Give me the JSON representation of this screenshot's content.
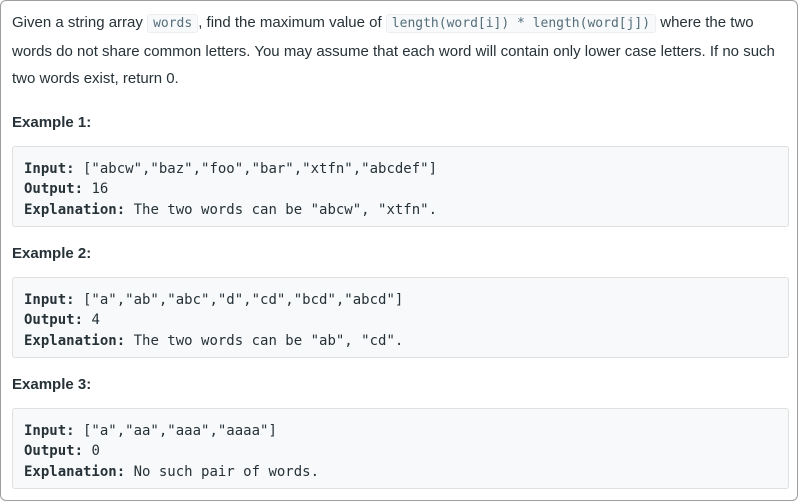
{
  "description": {
    "part1": "Given a string array ",
    "code1": "words",
    "part2": ", find the maximum value of ",
    "code2": "length(word[i]) * length(word[j])",
    "part3": " where the two words do not share common letters. You may assume that each word will contain only lower case letters. If no such two words exist, return 0."
  },
  "examples": [
    {
      "title": "Example 1:",
      "input_label": "Input:",
      "input_value": " [\"abcw\",\"baz\",\"foo\",\"bar\",\"xtfn\",\"abcdef\"]",
      "output_label": "Output:",
      "output_value": " 16",
      "explanation_label": "Explanation:",
      "explanation_value": " The two words can be \"abcw\", \"xtfn\"."
    },
    {
      "title": "Example 2:",
      "input_label": "Input:",
      "input_value": " [\"a\",\"ab\",\"abc\",\"d\",\"cd\",\"bcd\",\"abcd\"]",
      "output_label": "Output:",
      "output_value": " 4",
      "explanation_label": "Explanation:",
      "explanation_value": " The two words can be \"ab\", \"cd\"."
    },
    {
      "title": "Example 3:",
      "input_label": "Input:",
      "input_value": " [\"a\",\"aa\",\"aaa\",\"aaaa\"]",
      "output_label": "Output:",
      "output_value": " 0",
      "explanation_label": "Explanation:",
      "explanation_value": " No such pair of words."
    }
  ]
}
